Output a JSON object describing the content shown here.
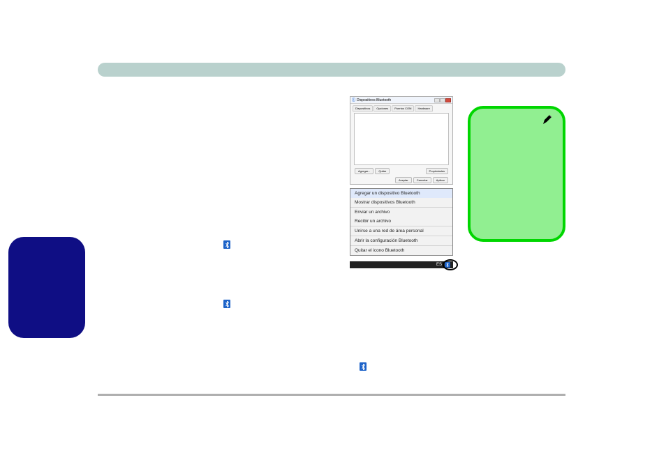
{
  "dialog": {
    "title": "Dispositivos Bluetooth",
    "tabs": [
      "Dispositivos",
      "Opciones",
      "Puertos COM",
      "Hardware"
    ],
    "buttons_row1_left": [
      "Agregar...",
      "Quitar"
    ],
    "buttons_row1_right": [
      "Propiedades"
    ],
    "buttons_row2": [
      "Aceptar",
      "Cancelar",
      "Aplicar"
    ]
  },
  "context_menu": {
    "items": [
      "Agregar un dispositivo Bluetooth",
      "Mostrar dispositivos Bluetooth",
      "Enviar un archivo",
      "Recibir un archivo",
      "Unirse a una red de área personal",
      "Abrir la configuración Bluetooth",
      "Quitar el icono Bluetooth"
    ],
    "highlight_index": 0
  },
  "taskbar": {
    "lang": "ES"
  },
  "icons": {
    "bluetooth_glyph": "B",
    "pen_name": "pencil-icon"
  }
}
